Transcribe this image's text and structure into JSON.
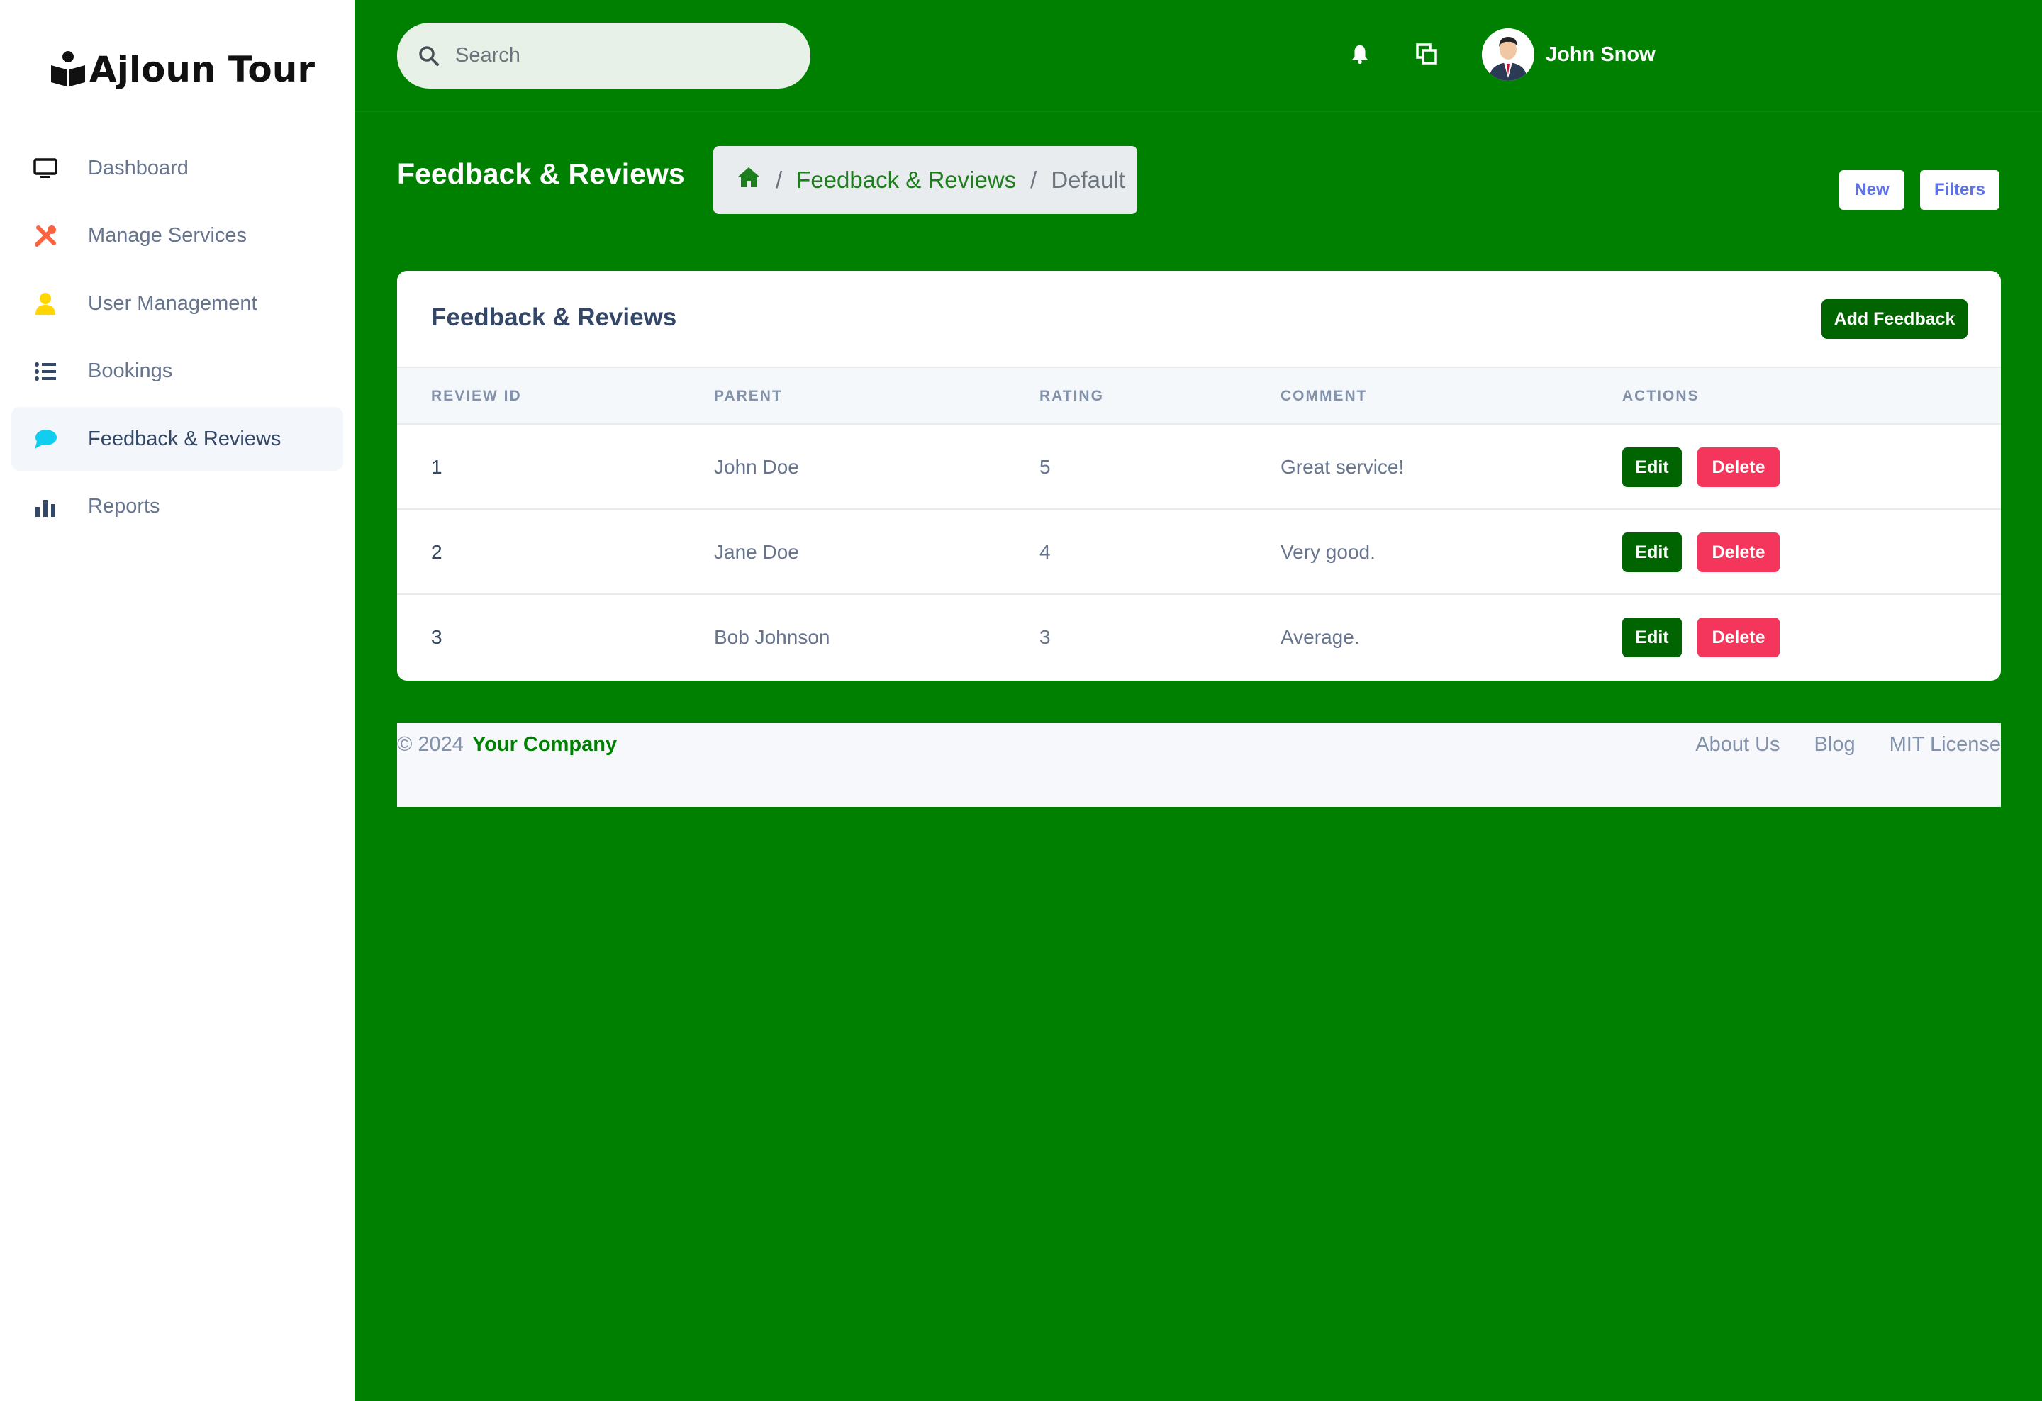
{
  "brand": {
    "name": "Ajloun Tour",
    "icon": "book-reader-icon"
  },
  "sidebar": {
    "items": [
      {
        "label": "Dashboard",
        "icon": "monitor-icon",
        "color": "#111111",
        "active": false
      },
      {
        "label": "Manage Services",
        "icon": "tools-icon",
        "color": "#fb6340",
        "active": false
      },
      {
        "label": "User Management",
        "icon": "user-icon",
        "color": "#ffd600",
        "active": false
      },
      {
        "label": "Bookings",
        "icon": "list-icon",
        "color": "#344767",
        "active": false
      },
      {
        "label": "Feedback & Reviews",
        "icon": "chat-bubble-icon",
        "color": "#11cdef",
        "active": true
      },
      {
        "label": "Reports",
        "icon": "bar-chart-icon",
        "color": "#344767",
        "active": false
      }
    ]
  },
  "topbar": {
    "search_placeholder": "Search",
    "user_name": "John Snow"
  },
  "header": {
    "title": "Feedback & Reviews",
    "breadcrumb": {
      "link": "Feedback & Reviews",
      "current": "Default"
    },
    "new_label": "New",
    "filters_label": "Filters"
  },
  "card": {
    "title": "Feedback & Reviews",
    "add_label": "Add Feedback",
    "columns": [
      "REVIEW ID",
      "PARENT",
      "RATING",
      "COMMENT",
      "ACTIONS"
    ],
    "rows": [
      {
        "id": "1",
        "parent": "John Doe",
        "rating": "5",
        "comment": "Great service!"
      },
      {
        "id": "2",
        "parent": "Jane Doe",
        "rating": "4",
        "comment": "Very good."
      },
      {
        "id": "3",
        "parent": "Bob Johnson",
        "rating": "3",
        "comment": "Average."
      }
    ],
    "edit_label": "Edit",
    "delete_label": "Delete"
  },
  "footer": {
    "copyright": "© 2024",
    "company": "Your Company",
    "links": [
      "About Us",
      "Blog",
      "MIT License"
    ]
  },
  "colors": {
    "background": "#008000",
    "primary_button": "#006400",
    "danger_button": "#f5365c"
  }
}
